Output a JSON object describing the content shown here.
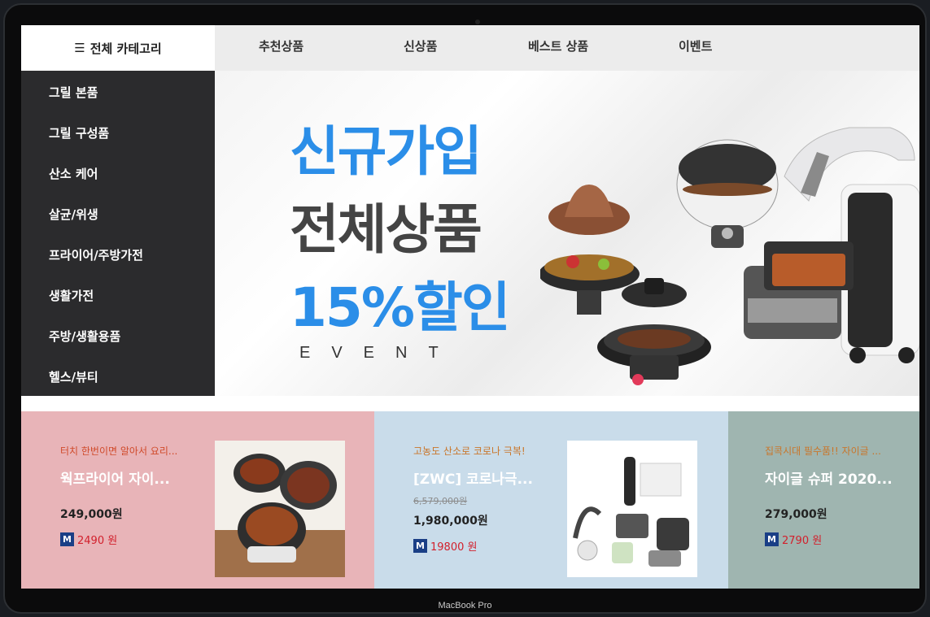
{
  "nav": {
    "all_categories": "전체 카테고리",
    "items": [
      "추천상품",
      "신상품",
      "베스트 상품",
      "이벤트"
    ]
  },
  "sidebar": {
    "items": [
      "그릴 본품",
      "그릴 구성품",
      "산소 케어",
      "살균/위생",
      "프라이어/주방가전",
      "생활가전",
      "주방/생활용품",
      "헬스/뷰티"
    ]
  },
  "banner": {
    "line1": "신규가입",
    "line2": "전체상품",
    "line3": "15%할인",
    "line4": "EVENT"
  },
  "cards": [
    {
      "tag": "터치 한번이면 알아서 요리...",
      "title": "웍프라이어 자이...",
      "old_price": "",
      "price": "249,000원",
      "mileage_badge": "M",
      "mileage": "2490 원",
      "bg": "#e8b4b8"
    },
    {
      "tag": "고농도 산소로 코로나 극복!",
      "title": "[ZWC] 코로나극...",
      "old_price": "6,579,000원",
      "price": "1,980,000원",
      "mileage_badge": "M",
      "mileage": "19800 원",
      "bg": "#c9dcea"
    },
    {
      "tag": "집콕시대 필수품!! 자이글 ...",
      "title": "자이글 슈퍼 2020...",
      "old_price": "",
      "price": "279,000원",
      "mileage_badge": "M",
      "mileage": "2790 원",
      "bg": "#9fb5b0"
    }
  ],
  "device_label": "MacBook Pro",
  "colors": {
    "accent_blue": "#2b8ee8",
    "sidebar_bg": "#2b2b2d",
    "mileage_red": "#d2202c",
    "badge_navy": "#1a3f86"
  }
}
